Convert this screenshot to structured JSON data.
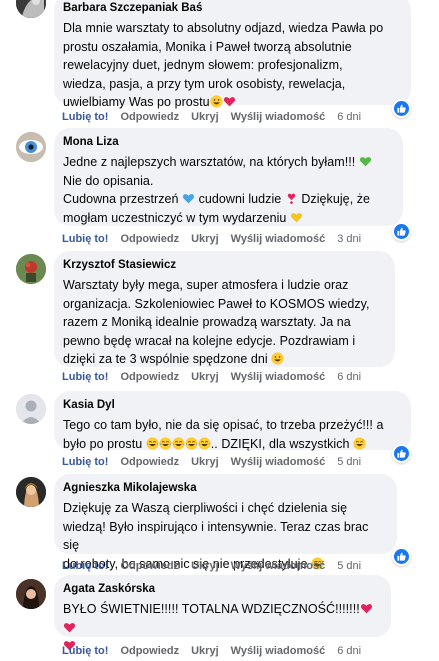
{
  "actions": {
    "like": "Lubię to!",
    "reply": "Odpowiedz",
    "hide": "Ukryj",
    "message": "Wyślij wiadomość"
  },
  "comments": [
    {
      "author": "Barbara Szczepaniak Baś",
      "lines": [
        "Dla mnie warsztaty to absolutny odjazd, wiedza Pawła po",
        "prostu oszałamia, Monika i Paweł tworzą absolutnie",
        "rewelacyjny duet, jednym słowem: profesjonalizm,",
        "wiedza, pasja, a przy tym urok osobisty, rewelacja,",
        "uwielbiamy Was po prostu"
      ],
      "time": "6 dni",
      "reaction_icon": "thumbs-up"
    },
    {
      "author": "Mona Liza",
      "lines": [
        "Jedne z najlepszych warsztatów, na których byłam!!!",
        "Nie do opisania.",
        "Cudowna przestrzeń",
        " cudowni ludzie",
        " Dziękuję, że",
        "mogłam uczestniczyć w tym wydarzeniu"
      ],
      "time": "3 dni",
      "reaction_icon": "thumbs-up"
    },
    {
      "author": "Krzysztof Stasiewicz",
      "lines": [
        "Warsztaty były mega, super atmosfera i ludzie oraz",
        "organizacja. Szkoleniowiec Paweł to KOSMOS wiedzy,",
        "razem z Moniką idealnie prowadzą warsztaty. Ja na",
        "pewno będę wracał na kolejne edycje. Pozdrawiam i",
        "dzięki za te 3 wspólnie spędzone dni"
      ],
      "time": "6 dni",
      "reaction_icon": "thumbs-up"
    },
    {
      "author": "Kasia Dyl",
      "lines": [
        "Tego co tam było, nie da się opisać, to trzeba przeżyć!!! a",
        "było po prostu",
        ".. DZIĘKI, dla wszystkich"
      ],
      "time": "5 dni",
      "reaction_icon": "thumbs-up"
    },
    {
      "author": "Agnieszka Mikolajewska",
      "lines": [
        "Dziękuję za Waszą cierpliwości i chęć dzielenia się",
        "wiedzą! Było inspirująco i intensywnie. Teraz czas brac się",
        "do roboty, bo samo nic się nie przedestyluje"
      ],
      "time": "5 dni",
      "reaction_icon": "thumbs-up"
    },
    {
      "author": "Agata Zaskórska",
      "lines": [
        "BYŁO ŚWIETNIE!!!!! TOTALNA WDZIĘCZNOŚĆ!!!!!!!"
      ],
      "time": "6 dni",
      "reaction_icon": "thumbs-up"
    }
  ],
  "colors": {
    "bubble": "#f0f2f5",
    "link": "#385898",
    "meta": "#65676b",
    "reaction": "#1877f2"
  }
}
